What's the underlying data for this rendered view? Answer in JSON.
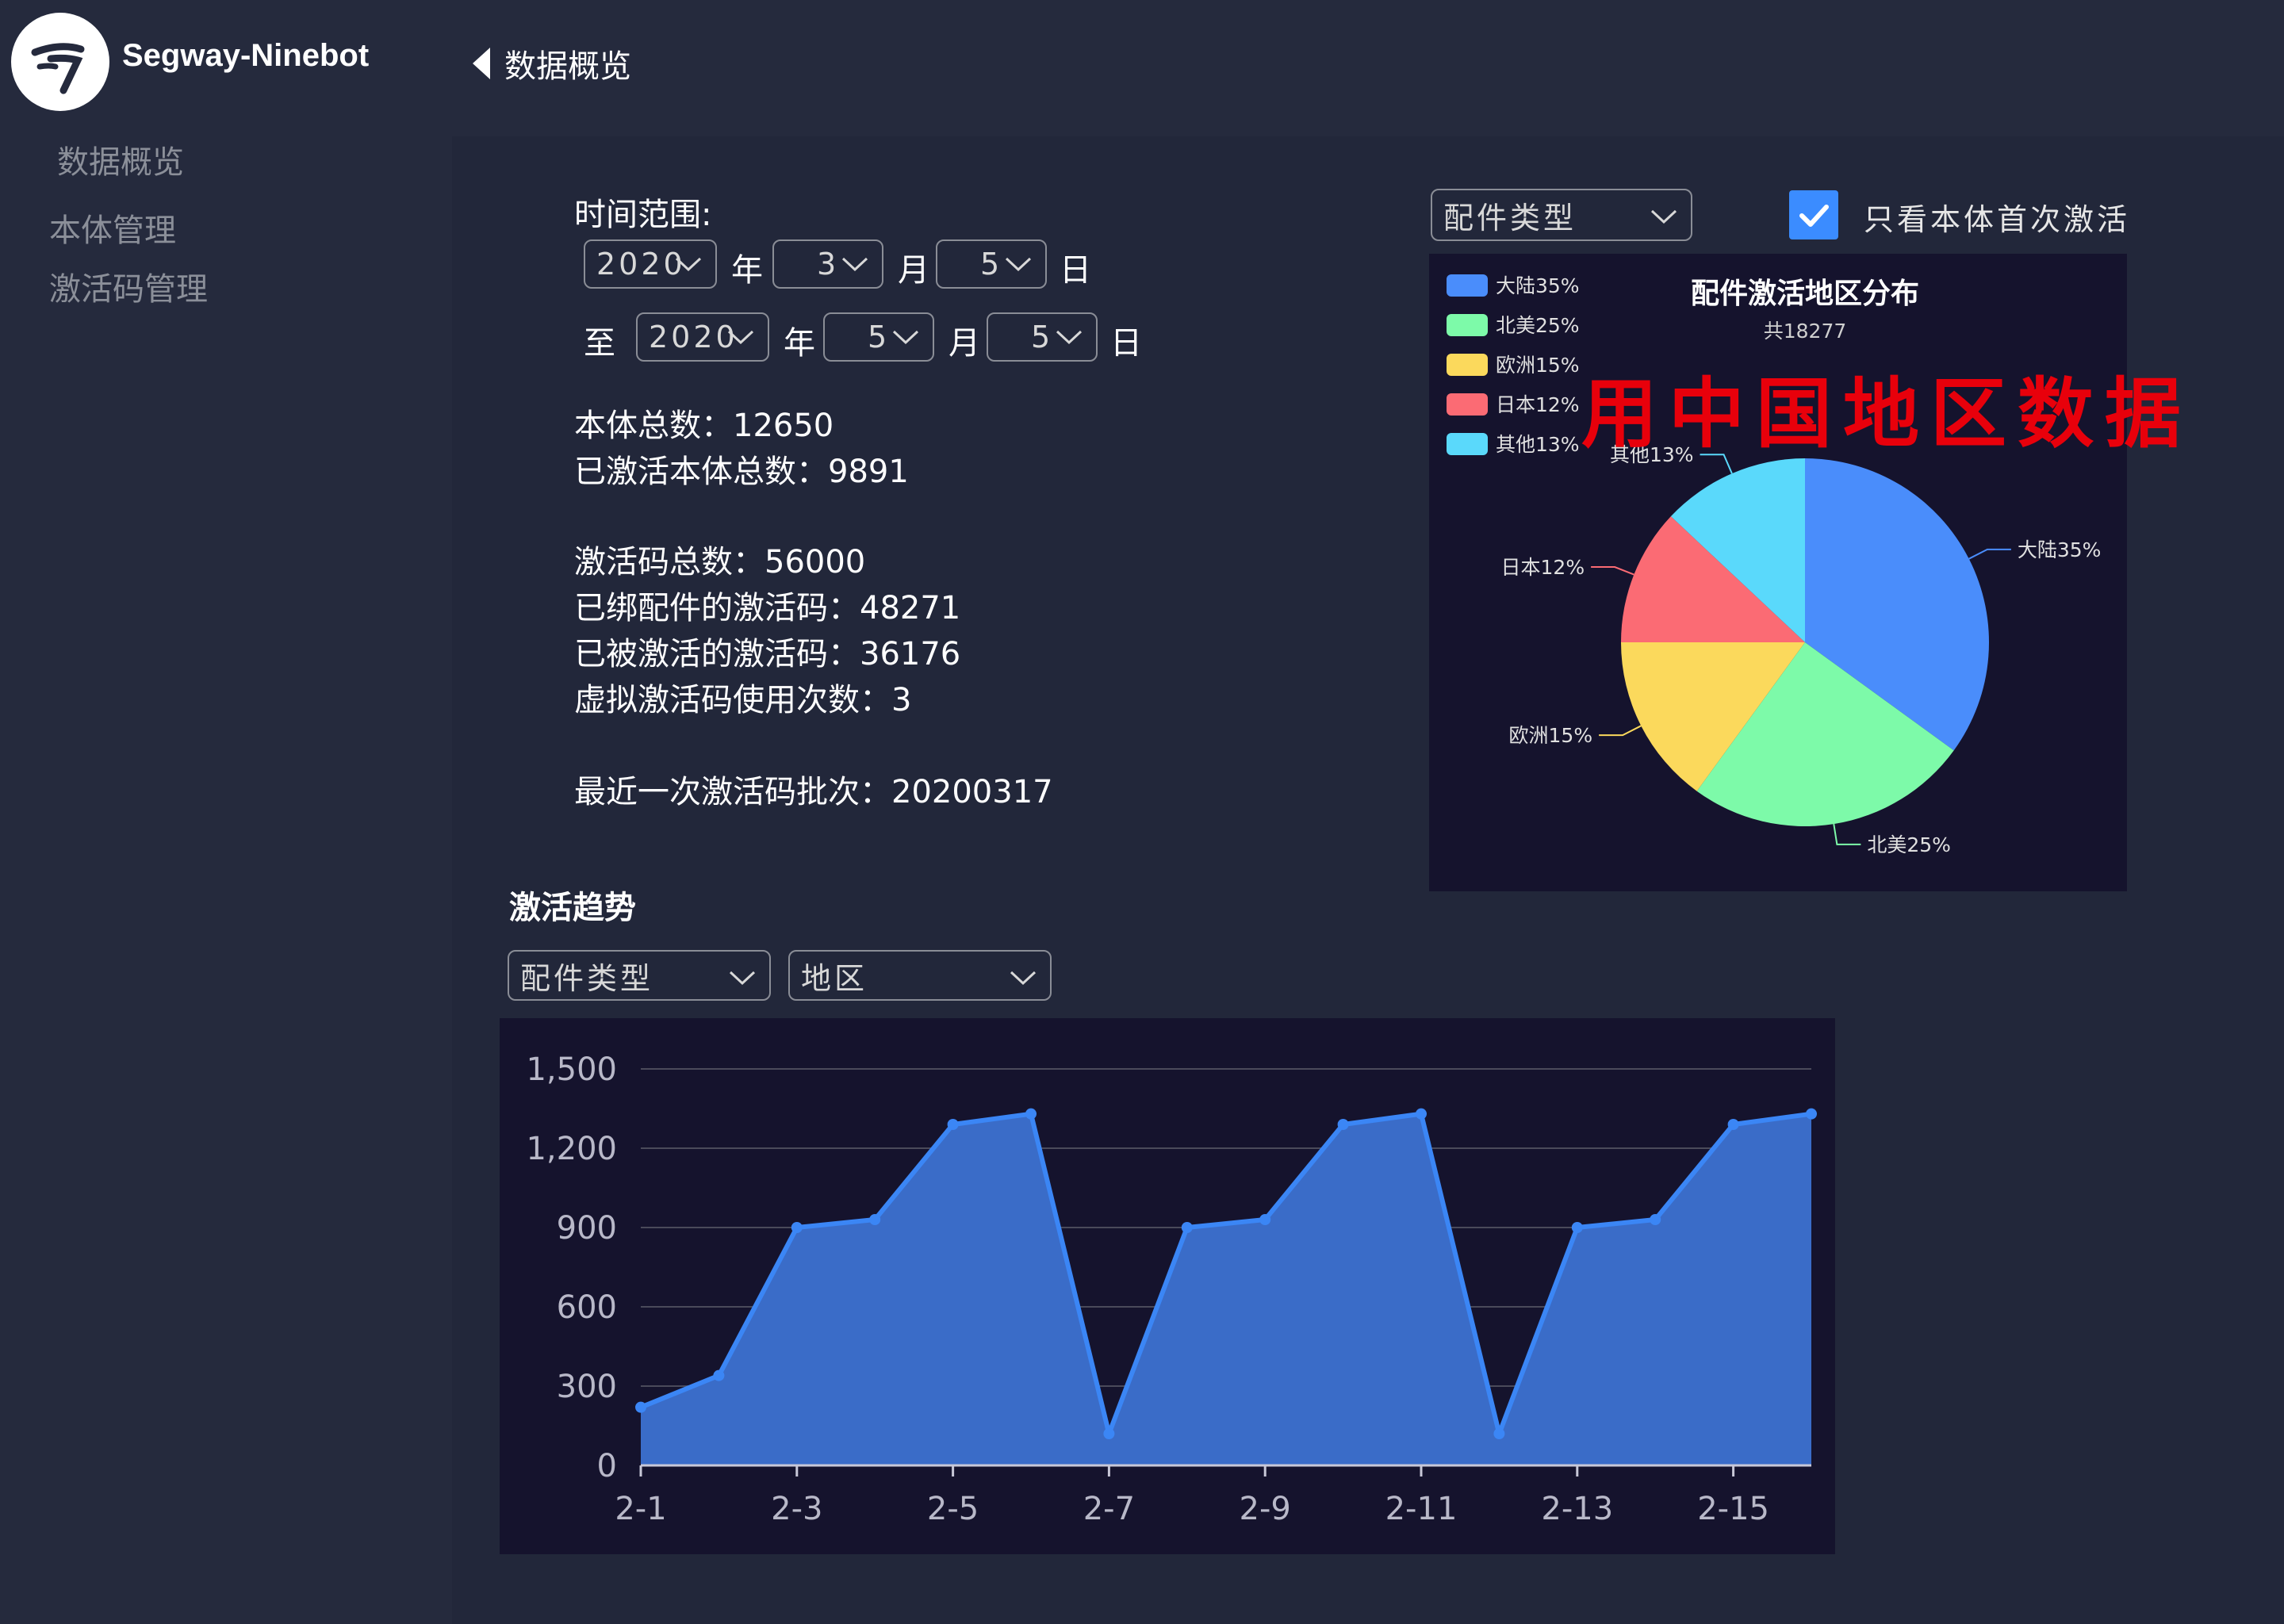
{
  "app": {
    "brand": "Segway-Ninebot",
    "back_label": "数据概览"
  },
  "sidebar": {
    "items": [
      {
        "label": "数据概览"
      },
      {
        "label": "本体管理"
      },
      {
        "label": "激活码管理"
      }
    ]
  },
  "filters": {
    "time_range_label": "时间范围:",
    "year_unit": "年",
    "month_unit": "月",
    "day_unit": "日",
    "to_label": "至",
    "start": {
      "year": "2020",
      "month": "3",
      "day": "5"
    },
    "end": {
      "year": "2020",
      "month": "5",
      "day": "5"
    }
  },
  "stats": {
    "body_total": "本体总数：12650",
    "body_activated": "已激活本体总数：9891",
    "code_total": "激活码总数：56000",
    "code_bound": "已绑配件的激活码：48271",
    "code_activated": "已被激活的激活码：36176",
    "virtual_used": "虚拟激活码使用次数：3",
    "latest_batch": "最近一次激活码批次：20200317"
  },
  "pie_controls": {
    "type_select": "配件类型",
    "checkbox_label": "只看本体首次激活",
    "checkbox_checked": true
  },
  "annotation": {
    "text": "用中国地区数据",
    "color": "#e8000b"
  },
  "pie_chart": {
    "title": "配件激活地区分布",
    "subtitle": "共18277",
    "legend": [
      {
        "label": "大陆35%",
        "color": "#4a8dfb"
      },
      {
        "label": "北美25%",
        "color": "#7dfaa9"
      },
      {
        "label": "欧洲15%",
        "color": "#fbd95c"
      },
      {
        "label": "日本12%",
        "color": "#fb6b74"
      },
      {
        "label": "其他13%",
        "color": "#5ad9fb"
      }
    ],
    "slice_labels": {
      "mainland": "大陆35%",
      "na": "北美25%",
      "eu": "欧洲15%",
      "jp": "日本12%",
      "other": "其他13%"
    }
  },
  "trend": {
    "title": "激活趋势",
    "type_select": "配件类型",
    "region_select": "地区"
  },
  "chart_data": [
    {
      "type": "pie",
      "title": "配件激活地区分布",
      "subtitle": "共18277",
      "categories": [
        "大陆",
        "北美",
        "欧洲",
        "日本",
        "其他"
      ],
      "values": [
        35,
        25,
        15,
        12,
        13
      ],
      "legend_position": "top-left",
      "colors": [
        "#4a8dfb",
        "#7dfaa9",
        "#fbd95c",
        "#fb6b74",
        "#5ad9fb"
      ]
    },
    {
      "type": "area",
      "title": "",
      "x": [
        "2-1",
        "2-2",
        "2-3",
        "2-4",
        "2-5",
        "2-6",
        "2-7",
        "2-8",
        "2-9",
        "2-10",
        "2-11",
        "2-12",
        "2-13",
        "2-14",
        "2-15",
        "2-16"
      ],
      "x_tick_labels": [
        "2-1",
        "2-3",
        "2-5",
        "2-7",
        "2-9",
        "2-11",
        "2-13",
        "2-15"
      ],
      "values": [
        220,
        340,
        900,
        930,
        1290,
        1330,
        120,
        900,
        930,
        1290,
        1330,
        120,
        900,
        930,
        1290,
        1330
      ],
      "ylim": [
        0,
        1500
      ],
      "y_ticks": [
        "0",
        "300",
        "600",
        "900",
        "1,200",
        "1,500"
      ],
      "y_tick_values": [
        0,
        300,
        600,
        900,
        1200,
        1500
      ],
      "grid": true,
      "line_color": "#3b86f5",
      "fill_color": "#3a6cc8"
    }
  ]
}
